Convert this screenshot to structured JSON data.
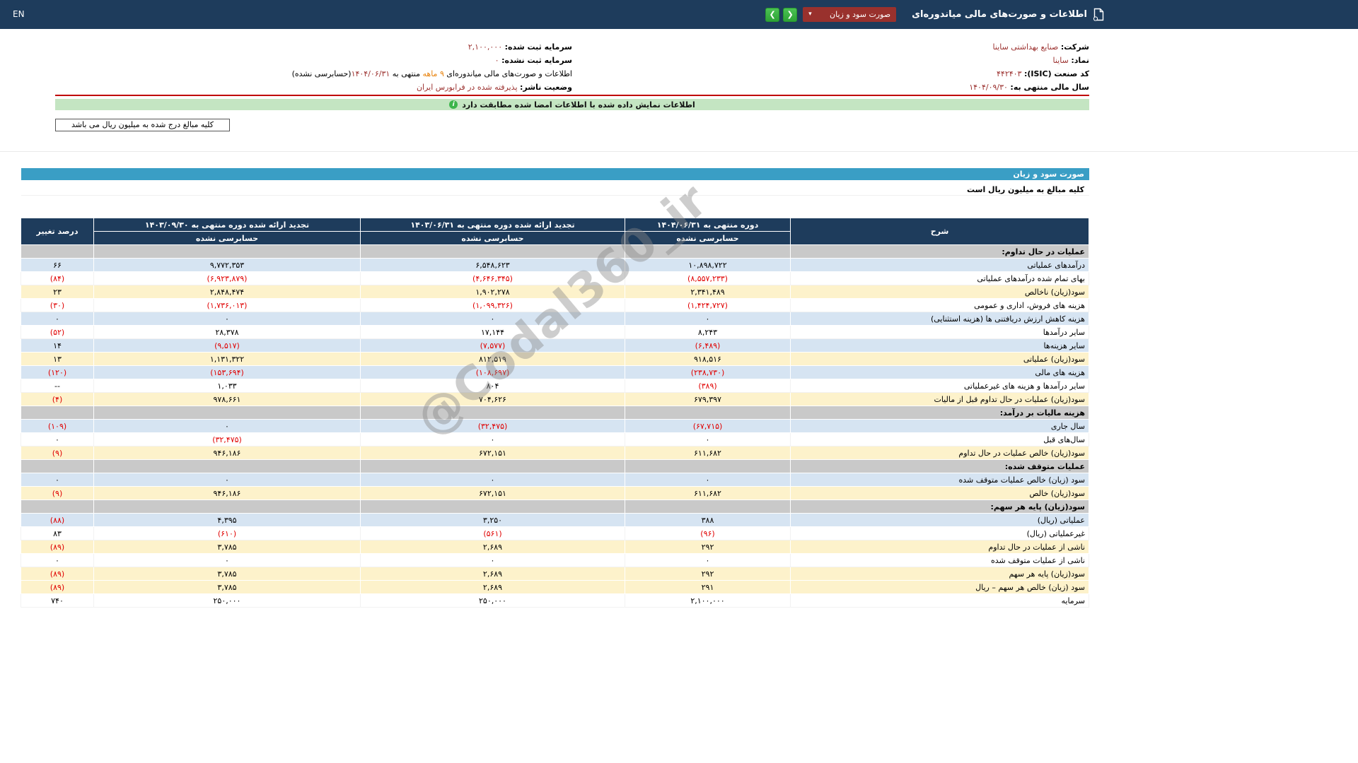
{
  "topbar": {
    "lang": "EN",
    "title": "اطلاعات و صورت‌های مالی میاندوره‌ای",
    "dropdown": {
      "selected": "صورت سود و زیان",
      "caret": "▾"
    },
    "nav": {
      "right_arrow": "❮",
      "left_arrow": "❯"
    }
  },
  "company_info": {
    "company_label": "شرکت:",
    "company_value": "صنایع بهداشتی ساینا",
    "symbol_label": "نماد:",
    "symbol_value": "ساینا",
    "isic_label": "کد صنعت (ISIC):",
    "isic_value": "۴۴۲۴۰۳",
    "fiscal_label": "سال مالی منتهی به:",
    "fiscal_value": "۱۴۰۴/۰۹/۳۰",
    "registered_capital_label": "سرمایه ثبت شده:",
    "registered_capital_value": "۲,۱۰۰,۰۰۰",
    "unregistered_capital_label": "سرمایه ثبت نشده:",
    "unregistered_capital_value": "۰",
    "report_title_prefix": "اطلاعات و صورت‌های مالی میاندوره‌ای",
    "report_period_highlight": "۹ ماهه",
    "report_middle": "منتهی به",
    "report_period_date": "۱۴۰۴/۰۶/۳۱",
    "report_suffix": "(حسابرسی نشده)",
    "publisher_label": "وضعیت ناشر:",
    "publisher_value": "پذیرفته شده در فرابورس ایران"
  },
  "banner": {
    "text": "اطلاعات نمایش داده شده با اطلاعات امضا شده مطابقت دارد",
    "icon": "i"
  },
  "notes": {
    "unit_box": "کلیه مبالغ درج شده به میلیون ریال می باشد"
  },
  "statement": {
    "title": "صورت سود و زیان",
    "unit_note": "کلیه مبالغ به میلیون ریال است"
  },
  "watermark": {
    "text": "@Codal360_ir"
  },
  "table": {
    "desc_header": "شرح",
    "change_header": "درصد تغییر",
    "period_headers": [
      "دوره منتهی به ۱۴۰۴/۰۶/۳۱",
      "تجدید ارائه شده دوره منتهی به ۱۴۰۳/۰۶/۳۱",
      "تجدید ارائه شده دوره منتهی به ۱۴۰۳/۰۹/۳۰"
    ],
    "audit_subheaders": [
      "حسابرسی نشده",
      "حسابرسی نشده",
      "حسابرسی نشده"
    ],
    "rows": [
      {
        "desc": "عملیات در حال تداوم:",
        "v1": "",
        "v2": "",
        "v3": "",
        "chg": "",
        "style": "section"
      },
      {
        "desc": "درآمدهای عملیاتی",
        "v1": "۱۰,۸۹۸,۷۲۲",
        "v2": "۶,۵۴۸,۶۲۳",
        "v3": "۹,۷۷۲,۳۵۳",
        "chg": "۶۶",
        "style": "alt"
      },
      {
        "desc": "بهای تمام شده درآمدهای عملیاتی",
        "v1": "(۸,۵۵۷,۲۳۳)",
        "v2": "(۴,۶۴۶,۳۴۵)",
        "v3": "(۶,۹۲۳,۸۷۹)",
        "chg": "(۸۴)",
        "style": "plain"
      },
      {
        "desc": "سود(زیان) ناخالص",
        "v1": "۲,۳۴۱,۴۸۹",
        "v2": "۱,۹۰۲,۲۷۸",
        "v3": "۲,۸۴۸,۴۷۴",
        "chg": "۲۳",
        "style": "total"
      },
      {
        "desc": "هزینه های فروش، اداری و عمومی",
        "v1": "(۱,۴۲۴,۷۲۷)",
        "v2": "(۱,۰۹۹,۳۲۶)",
        "v3": "(۱,۷۳۶,۰۱۳)",
        "chg": "(۳۰)",
        "style": "plain"
      },
      {
        "desc": "هزینه کاهش ارزش دریافتنی ها (هزینه استثنایی)",
        "v1": "۰",
        "v2": "۰",
        "v3": "۰",
        "chg": "۰",
        "style": "alt"
      },
      {
        "desc": "سایر درآمدها",
        "v1": "۸,۲۴۳",
        "v2": "۱۷,۱۴۴",
        "v3": "۲۸,۳۷۸",
        "chg": "(۵۲)",
        "style": "plain"
      },
      {
        "desc": "سایر هزینه‌ها",
        "v1": "(۶,۴۸۹)",
        "v2": "(۷,۵۷۷)",
        "v3": "(۹,۵۱۷)",
        "chg": "۱۴",
        "style": "alt"
      },
      {
        "desc": "سود(زیان) عملیاتی",
        "v1": "۹۱۸,۵۱۶",
        "v2": "۸۱۲,۵۱۹",
        "v3": "۱,۱۳۱,۳۲۲",
        "chg": "۱۳",
        "style": "total"
      },
      {
        "desc": "هزینه های مالی",
        "v1": "(۲۳۸,۷۳۰)",
        "v2": "(۱۰۸,۶۹۷)",
        "v3": "(۱۵۳,۶۹۴)",
        "chg": "(۱۲۰)",
        "style": "alt"
      },
      {
        "desc": "سایر درآمدها و هزینه های غیرعملیاتی",
        "v1": "(۳۸۹)",
        "v2": "۸۰۴",
        "v3": "۱,۰۳۳",
        "chg": "--",
        "style": "plain"
      },
      {
        "desc": "سود(زیان) عملیات در حال تداوم قبل از مالیات",
        "v1": "۶۷۹,۳۹۷",
        "v2": "۷۰۴,۶۲۶",
        "v3": "۹۷۸,۶۶۱",
        "chg": "(۴)",
        "style": "total"
      },
      {
        "desc": "هزینه مالیات بر درآمد:",
        "v1": "",
        "v2": "",
        "v3": "",
        "chg": "",
        "style": "section"
      },
      {
        "desc": "سال جاری",
        "v1": "(۶۷,۷۱۵)",
        "v2": "(۳۲,۴۷۵)",
        "v3": "۰",
        "chg": "(۱۰۹)",
        "style": "alt"
      },
      {
        "desc": "سال‌های قبل",
        "v1": "۰",
        "v2": "۰",
        "v3": "(۳۲,۴۷۵)",
        "chg": "۰",
        "style": "plain"
      },
      {
        "desc": "سود(زیان) خالص عملیات در حال تداوم",
        "v1": "۶۱۱,۶۸۲",
        "v2": "۶۷۲,۱۵۱",
        "v3": "۹۴۶,۱۸۶",
        "chg": "(۹)",
        "style": "total"
      },
      {
        "desc": "عملیات متوقف شده:",
        "v1": "",
        "v2": "",
        "v3": "",
        "chg": "",
        "style": "section"
      },
      {
        "desc": "سود (زیان) خالص عملیات متوقف شده",
        "v1": "۰",
        "v2": "۰",
        "v3": "۰",
        "chg": "۰",
        "style": "alt"
      },
      {
        "desc": "سود(زیان) خالص",
        "v1": "۶۱۱,۶۸۲",
        "v2": "۶۷۲,۱۵۱",
        "v3": "۹۴۶,۱۸۶",
        "chg": "(۹)",
        "style": "total"
      },
      {
        "desc": "سود(زیان) پایه هر سهم:",
        "v1": "",
        "v2": "",
        "v3": "",
        "chg": "",
        "style": "section"
      },
      {
        "desc": "عملیاتی (ریال)",
        "v1": "۳۸۸",
        "v2": "۳,۲۵۰",
        "v3": "۴,۳۹۵",
        "chg": "(۸۸)",
        "style": "alt"
      },
      {
        "desc": "غیرعملیاتی (ریال)",
        "v1": "(۹۶)",
        "v2": "(۵۶۱)",
        "v3": "(۶۱۰)",
        "chg": "۸۳",
        "style": "plain"
      },
      {
        "desc": "ناشی از عملیات در حال تداوم",
        "v1": "۲۹۲",
        "v2": "۲,۶۸۹",
        "v3": "۳,۷۸۵",
        "chg": "(۸۹)",
        "style": "total"
      },
      {
        "desc": "ناشی از عملیات متوقف شده",
        "v1": "۰",
        "v2": "۰",
        "v3": "۰",
        "chg": "۰",
        "style": "plain"
      },
      {
        "desc": "سود(زیان) پایه هر سهم",
        "v1": "۲۹۲",
        "v2": "۲,۶۸۹",
        "v3": "۳,۷۸۵",
        "chg": "(۸۹)",
        "style": "total"
      },
      {
        "desc": "سود (زیان) خالص هر سهم – ریال",
        "v1": "۲۹۱",
        "v2": "۲,۶۸۹",
        "v3": "۳,۷۸۵",
        "chg": "(۸۹)",
        "style": "total"
      },
      {
        "desc": "سرمایه",
        "v1": "۲,۱۰۰,۰۰۰",
        "v2": "۲۵۰,۰۰۰",
        "v3": "۲۵۰,۰۰۰",
        "chg": "۷۴۰",
        "style": "plain"
      }
    ]
  }
}
